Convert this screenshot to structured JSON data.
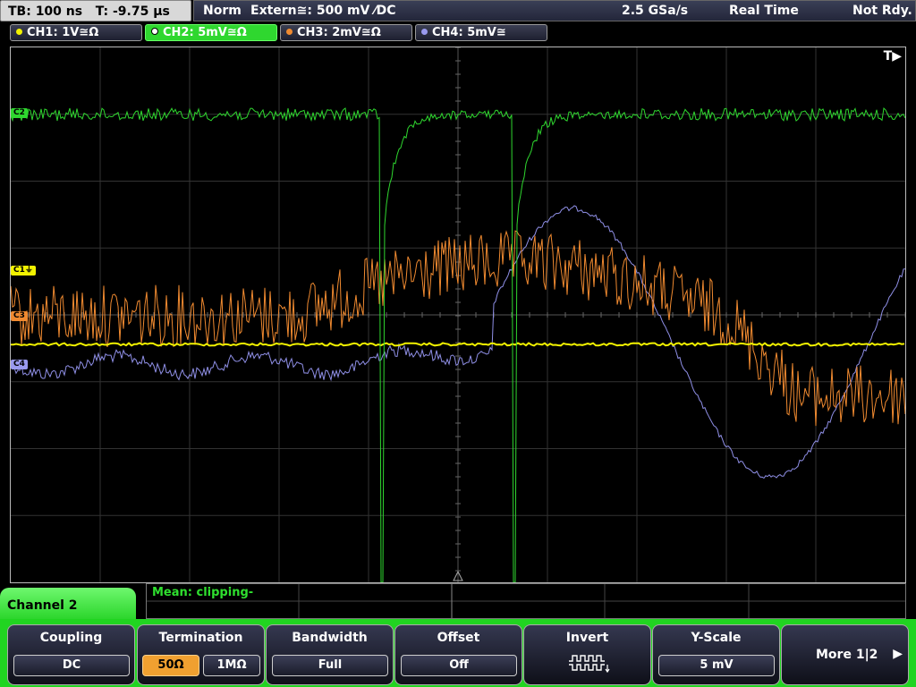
{
  "status": {
    "timebase": "TB: 100 ns   T: -9.75 µs",
    "mode": "Norm",
    "trigger": "Extern≅: 500 mV ⁄DC",
    "sample_rate": "2.5 GSa/s",
    "acq_mode": "Real Time",
    "state": "Not Rdy."
  },
  "channels": [
    {
      "label": "CH1: 1V≅Ω",
      "color": "#f2f200",
      "active": false
    },
    {
      "label": "CH2: 5mV≅Ω",
      "color": "#2fd72f",
      "active": true
    },
    {
      "label": "CH3: 2mV≅Ω",
      "color": "#f08a30",
      "active": false
    },
    {
      "label": "CH4: 5mV≅",
      "color": "#9a9aee",
      "active": false
    }
  ],
  "markers": {
    "trigger": "T▶",
    "c2": "C2",
    "c1": "C1⏚",
    "c3": "C3",
    "c4": "C4"
  },
  "measurement": {
    "text": "Mean: clipping-"
  },
  "menu": {
    "title": "Channel 2",
    "coupling": {
      "title": "Coupling",
      "value": "DC"
    },
    "termination": {
      "title": "Termination",
      "opt1": "50Ω",
      "opt2": "1MΩ",
      "selected": "50Ω"
    },
    "bandwidth": {
      "title": "Bandwidth",
      "value": "Full"
    },
    "offset": {
      "title": "Offset",
      "value": "Off"
    },
    "invert": {
      "title": "Invert",
      "icon": "pulse-invert-icon"
    },
    "yscale": {
      "title": "Y-Scale",
      "value": "5 mV"
    },
    "more": {
      "label": "More 1|2",
      "icon": "arrow-right-icon"
    }
  }
}
